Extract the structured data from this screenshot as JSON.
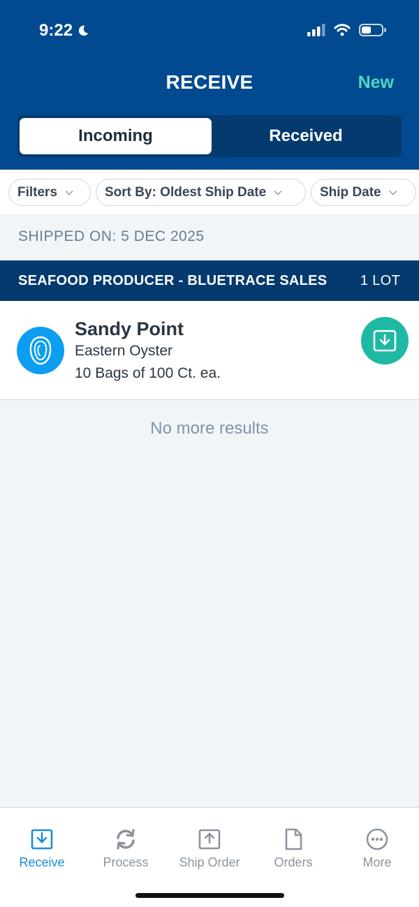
{
  "status_bar": {
    "time": "9:22"
  },
  "header": {
    "title": "RECEIVE",
    "new_label": "New"
  },
  "segment": {
    "incoming": "Incoming",
    "received": "Received",
    "selected": "incoming"
  },
  "filters": {
    "filters_label": "Filters",
    "sort_label": "Sort By: Oldest Ship Date",
    "ship_date_label": "Ship Date"
  },
  "shipped_on": "SHIPPED ON: 5 DEC 2025",
  "producer": {
    "name": "SEAFOOD PRODUCER - BLUETRACE SALES",
    "lot_count": "1 LOT"
  },
  "lot": {
    "name": "Sandy Point",
    "species": "Eastern Oyster",
    "quantity": "10 Bags of 100 Ct. ea."
  },
  "no_more_results": "No more results",
  "tabs": [
    {
      "label": "Receive",
      "icon": "receive-icon",
      "active": true
    },
    {
      "label": "Process",
      "icon": "process-icon",
      "active": false
    },
    {
      "label": "Ship Order",
      "icon": "ship-order-icon",
      "active": false
    },
    {
      "label": "Orders",
      "icon": "orders-icon",
      "active": false
    },
    {
      "label": "More",
      "icon": "more-icon",
      "active": false
    }
  ],
  "colors": {
    "header": "#014a8f",
    "accent": "#4fd6c4",
    "receive_button": "#1fb8a3",
    "active_tab": "#1a8ce0"
  }
}
